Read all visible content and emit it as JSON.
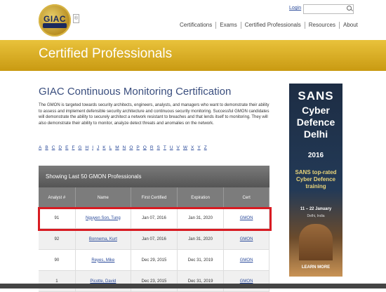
{
  "header": {
    "logo_text": "GIAC",
    "trademark": "®",
    "login_label": "Login",
    "search": {
      "placeholder": ""
    },
    "nav": [
      "Certifications",
      "Exams",
      "Certified Professionals",
      "Resources",
      "About"
    ]
  },
  "banner": {
    "title": "Certified Professionals"
  },
  "main": {
    "title": "GIAC Continuous Monitoring Certification",
    "intro": "The GMON is targeted towards security architects, engineers, analysts, and managers who want to demonstrate their ability to assess and implement defensible security architecture and continuous security monitoring. Successful GMON candidates will demonstrate the ability to securely architect a network resistant to breaches and that lends itself to monitoring. They will also demonstrate their ability to monitor, analyze detect threats and anomalies on the network.",
    "alphabet": [
      "A",
      "B",
      "C",
      "D",
      "E",
      "F",
      "G",
      "H",
      "I",
      "J",
      "K",
      "L",
      "M",
      "N",
      "O",
      "P",
      "Q",
      "R",
      "S",
      "T",
      "U",
      "V",
      "W",
      "X",
      "Y",
      "Z"
    ],
    "table_caption": "Showing Last 50 GMON Professionals",
    "columns": [
      "Analyst #",
      "Name",
      "First Certified",
      "Expiration",
      "Cert"
    ],
    "rows": [
      {
        "analyst": "91",
        "name": "Nguyen Son, Tung",
        "first": "Jan 07, 2016",
        "expiration": "Jan 31, 2020",
        "cert": "GMON"
      },
      {
        "analyst": "92",
        "name": "Bonnema, Kurt",
        "first": "Jan 07, 2016",
        "expiration": "Jan 31, 2020",
        "cert": "GMON"
      },
      {
        "analyst": "90",
        "name": "Reyes, Mike",
        "first": "Dec 29, 2015",
        "expiration": "Dec 31, 2019",
        "cert": "GMON"
      },
      {
        "analyst": "1",
        "name": "Picotte, David",
        "first": "Dec 23, 2015",
        "expiration": "Dec 31, 2019",
        "cert": "GMON"
      }
    ]
  },
  "ad": {
    "brand": "SANS",
    "headline": "Cyber Defence Delhi",
    "year": "2016",
    "sub": "SANS top-rated Cyber Defence training",
    "dates": "11 – 22 January",
    "place": "Delhi, India",
    "cta": "LEARN MORE"
  },
  "colors": {
    "banner": "#d4a820",
    "title": "#3a4e7e",
    "link": "#2a4a9a",
    "highlight": "#d81b22"
  }
}
